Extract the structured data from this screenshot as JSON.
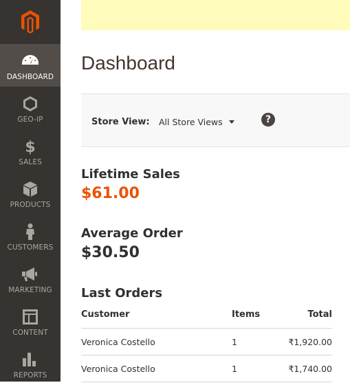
{
  "sidebar": {
    "logo": "magento-logo",
    "items": [
      {
        "label": "DASHBOARD",
        "icon": "speedometer-icon",
        "active": true
      },
      {
        "label": "GEO-IP",
        "icon": "hexagon-icon",
        "active": false
      },
      {
        "label": "SALES",
        "icon": "dollar-icon",
        "active": false
      },
      {
        "label": "PRODUCTS",
        "icon": "box-icon",
        "active": false
      },
      {
        "label": "CUSTOMERS",
        "icon": "person-icon",
        "active": false
      },
      {
        "label": "MARKETING",
        "icon": "megaphone-icon",
        "active": false
      },
      {
        "label": "CONTENT",
        "icon": "layout-icon",
        "active": false
      },
      {
        "label": "REPORTS",
        "icon": "bar-chart-icon",
        "active": false
      }
    ]
  },
  "page": {
    "title": "Dashboard"
  },
  "store_switcher": {
    "label": "Store View:",
    "selected": "All Store Views",
    "help": "?"
  },
  "stats": {
    "lifetime_sales": {
      "label": "Lifetime Sales",
      "value": "$61.00"
    },
    "average_order": {
      "label": "Average Order",
      "value": "$30.50"
    }
  },
  "last_orders": {
    "title": "Last Orders",
    "columns": {
      "customer": "Customer",
      "items": "Items",
      "total": "Total"
    },
    "rows": [
      {
        "customer": "Veronica Costello",
        "items": "1",
        "total": "₹1,920.00"
      },
      {
        "customer": "Veronica Costello",
        "items": "1",
        "total": "₹1,740.00"
      }
    ]
  },
  "colors": {
    "sidebar": "#373330",
    "sidebar_active": "#524d49",
    "brand_orange": "#eb5202",
    "notice_bg": "#fffbbb"
  }
}
